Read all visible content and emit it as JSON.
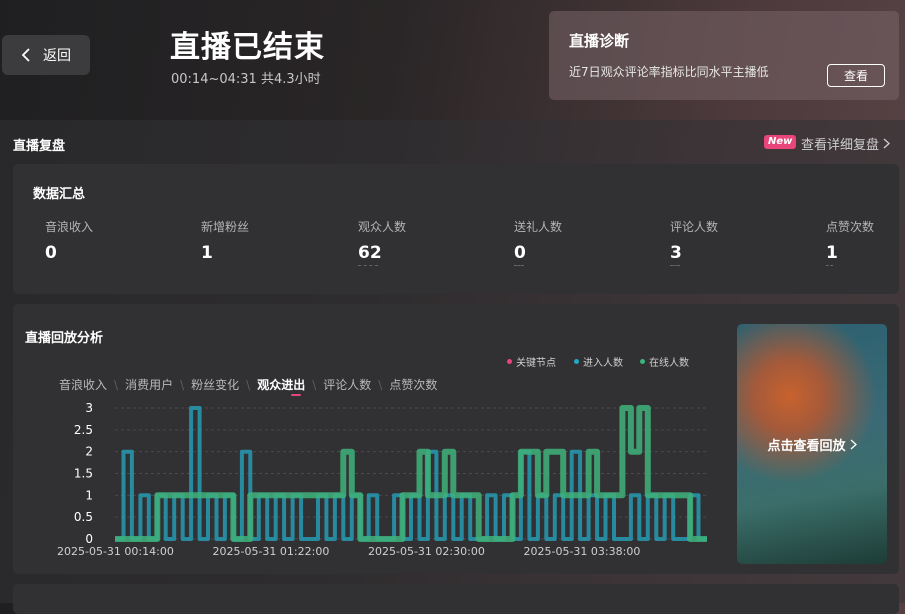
{
  "header": {
    "back_label": "返回",
    "title": "直播已结束",
    "subtitle": "00:14~04:31 共4.3小时"
  },
  "diagnosis": {
    "title": "直播诊断",
    "text": "近7日观众评论率指标比同水平主播低",
    "button": "查看"
  },
  "review": {
    "title": "直播复盘",
    "new_badge": "New",
    "detail_link": "查看详细复盘"
  },
  "summary": {
    "title": "数据汇总",
    "stats": [
      {
        "label": "音浪收入",
        "value": "0"
      },
      {
        "label": "新增粉丝",
        "value": "1"
      },
      {
        "label": "观众人数",
        "value": "62"
      },
      {
        "label": "送礼人数",
        "value": "0"
      },
      {
        "label": "评论人数",
        "value": "3"
      },
      {
        "label": "点赞次数",
        "value": "1"
      }
    ]
  },
  "replay": {
    "title": "直播回放分析",
    "legend": [
      "关键节点",
      "进入人数",
      "在线人数"
    ],
    "tabs": [
      "音浪收入",
      "消费用户",
      "粉丝变化",
      "观众进出",
      "评论人数",
      "点赞次数"
    ],
    "active_tab": 3,
    "video_label": "点击查看回放"
  },
  "colors": {
    "key_node": "#e8457a",
    "enter": "#24a8c4",
    "online": "#3fb27a"
  },
  "chart_data": {
    "type": "line",
    "title": "",
    "ylim": [
      0,
      3
    ],
    "yticks": [
      "3",
      "2.5",
      "2",
      "1.5",
      "1",
      "0.5",
      "0"
    ],
    "xticks": [
      "2025-05-31 00:14:00",
      "2025-05-31 01:22:00",
      "2025-05-31 02:30:00",
      "2025-05-31 03:38:00"
    ],
    "series": [
      {
        "name": "进入人数",
        "values": [
          0,
          2,
          0,
          1,
          0,
          1,
          0,
          1,
          0,
          3,
          0,
          1,
          0,
          1,
          0,
          2,
          0,
          1,
          0,
          1,
          0,
          1,
          0,
          0,
          1,
          0,
          1,
          0,
          1,
          0,
          1,
          0,
          0,
          1,
          0,
          1,
          0,
          2,
          0,
          1,
          0,
          1,
          0,
          0,
          1,
          0,
          1,
          0,
          2,
          0,
          1,
          0,
          1,
          0,
          2,
          0,
          1,
          0,
          1,
          0,
          0,
          1,
          0,
          1,
          0,
          1,
          0,
          0,
          1,
          0
        ]
      },
      {
        "name": "在线人数",
        "values": [
          0,
          0,
          0,
          0,
          0,
          1,
          1,
          1,
          1,
          1,
          1,
          1,
          1,
          1,
          0,
          0,
          1,
          1,
          1,
          1,
          1,
          1,
          1,
          1,
          1,
          1,
          1,
          2,
          1,
          0,
          0,
          0,
          0,
          0,
          1,
          1,
          2,
          1,
          1,
          2,
          1,
          1,
          1,
          0,
          0,
          0,
          0,
          1,
          2,
          2,
          1,
          2,
          2,
          1,
          1,
          1,
          2,
          1,
          1,
          1,
          3,
          2,
          3,
          1,
          1,
          1,
          1,
          1,
          0,
          0
        ]
      }
    ]
  }
}
